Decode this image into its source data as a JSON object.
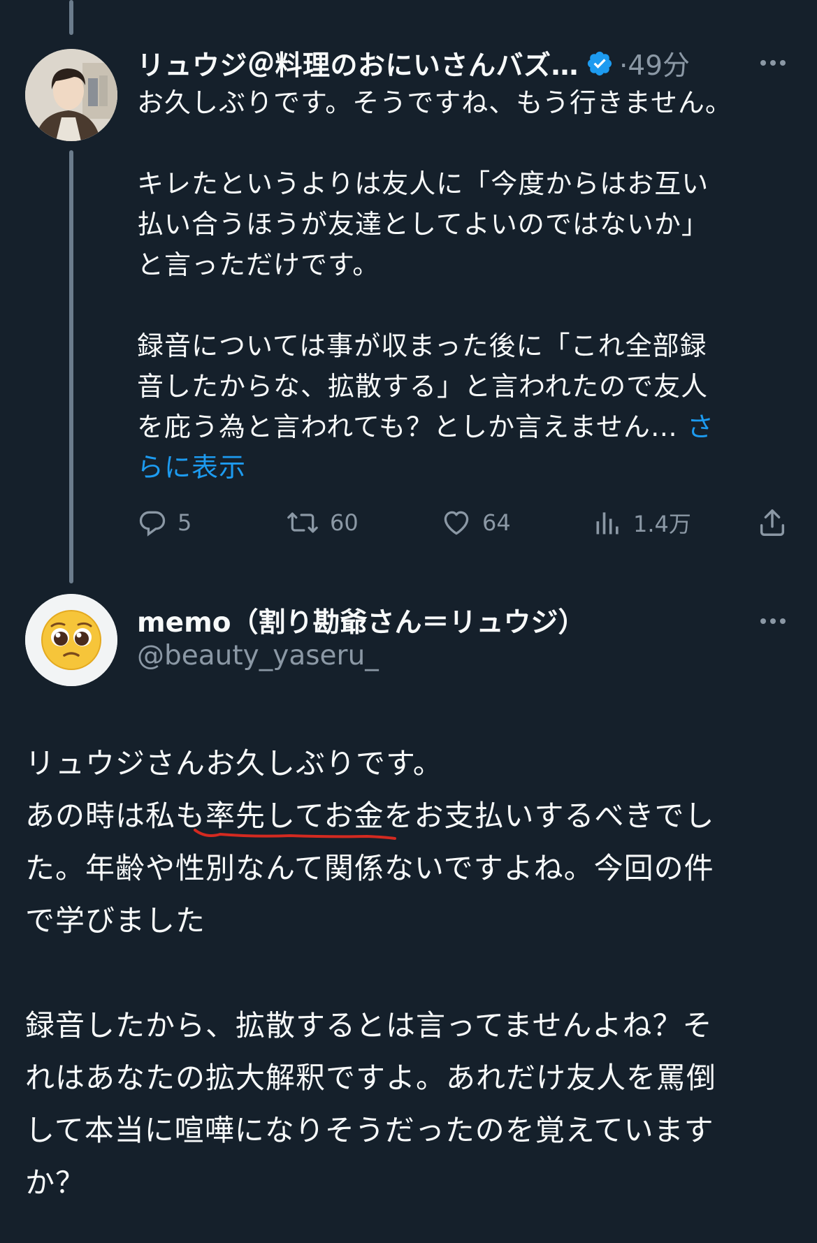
{
  "tweet1": {
    "author_name": "リュウジ＠料理のおにいさんバズ…",
    "time": "·49分",
    "body": {
      "p1": "お久しぶりです。そうですね、もう行きません。",
      "p2_l1": "キレたというよりは友人に「今度からはお互い",
      "p2_l2": "払い合うほうが友達としてよいのではないか」",
      "p2_l3": "と言っただけです。",
      "p3_l1": "録音については事が収まった後に「これ全部録",
      "p3_l2": "音したからな、拡散する」と言われたので友人",
      "p3_l3": "を庇う為と言われても？としか言えません… ",
      "show_more_a": "さ",
      "show_more_b": "らに表示"
    },
    "actions": {
      "replies": "5",
      "retweets": "60",
      "likes": "64",
      "views": "1.4万"
    },
    "icons": [
      "reply-icon",
      "retweet-icon",
      "like-icon",
      "views-icon",
      "share-icon",
      "verified-icon",
      "more-icon"
    ],
    "colors": {
      "accent": "#1d9bf0",
      "muted": "#8b98a5",
      "background": "#15202b"
    }
  },
  "tweet2": {
    "author_name": "memo（割り勘爺さん＝リュウジ）",
    "handle": "@beauty_yaseru_",
    "avatar_emoji": "🥺",
    "body": {
      "l1": "リュウジさんお久しぶりです。",
      "l2a": "あの時は私も",
      "l2b": "率先して",
      "l2c": "お金をお支払いするべきでし",
      "l3": "た。年齢や性別なんて関係ないですよね。今回の件",
      "l4": "で学びました",
      "l5": "録音したから、拡散するとは言ってませんよね？そ",
      "l6": "れはあなたの拡大解釈ですよ。あれだけ友人を罵倒",
      "l7": "して本当に喧嘩になりそうだったのを覚えています",
      "l8": "か？"
    },
    "annotation_color": "#d42a20"
  }
}
